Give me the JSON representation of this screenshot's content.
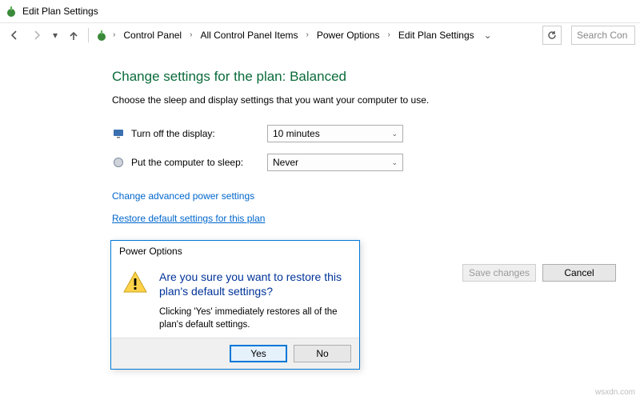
{
  "window": {
    "title": "Edit Plan Settings"
  },
  "breadcrumb": {
    "items": [
      "Control Panel",
      "All Control Panel Items",
      "Power Options",
      "Edit Plan Settings"
    ]
  },
  "search": {
    "placeholder": "Search Con"
  },
  "page": {
    "heading": "Change settings for the plan: Balanced",
    "subtext": "Choose the sleep and display settings that you want your computer to use."
  },
  "settings": {
    "display": {
      "label": "Turn off the display:",
      "value": "10 minutes"
    },
    "sleep": {
      "label": "Put the computer to sleep:",
      "value": "Never"
    }
  },
  "links": {
    "advanced": "Change advanced power settings",
    "restore": "Restore default settings for this plan"
  },
  "buttons": {
    "save": "Save changes",
    "cancel": "Cancel"
  },
  "dialog": {
    "title": "Power Options",
    "main": "Are you sure you want to restore this plan's default settings?",
    "sub": "Clicking 'Yes' immediately restores all of the plan's default settings.",
    "yes": "Yes",
    "no": "No"
  },
  "watermark": "wsxdn.com"
}
